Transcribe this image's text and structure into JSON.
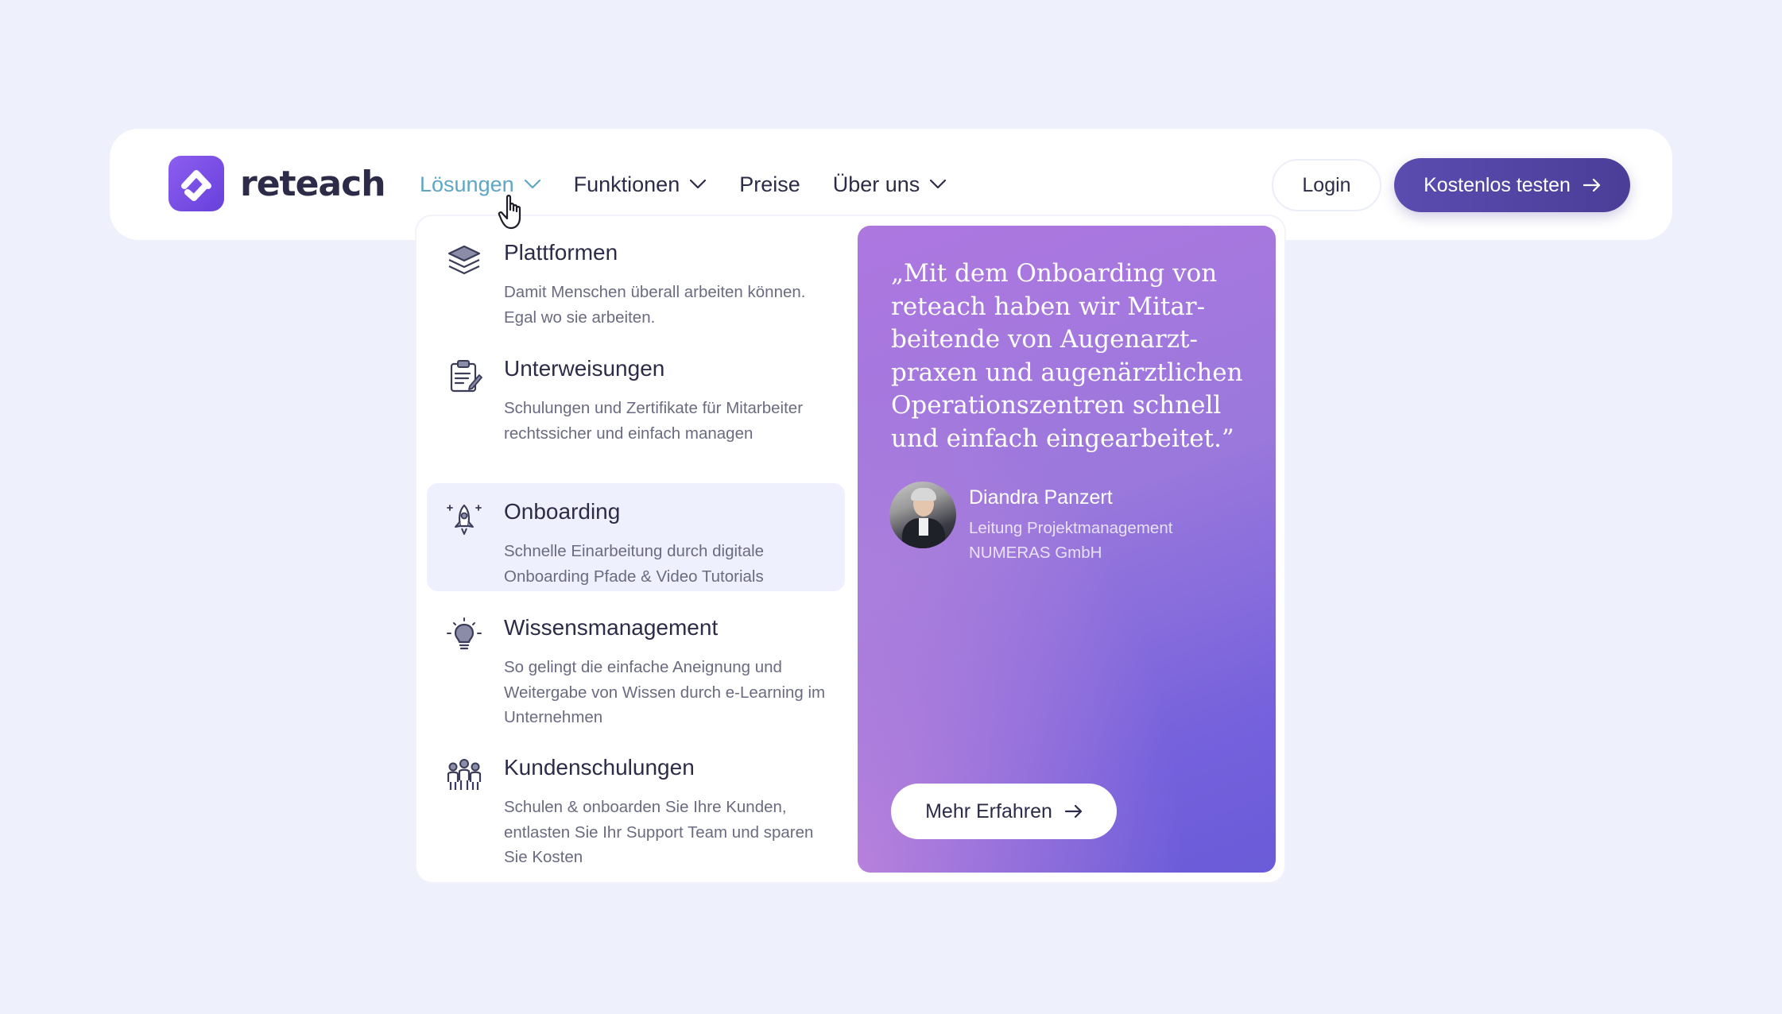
{
  "brand": {
    "name": "reteach",
    "color": "#7048e0"
  },
  "nav": {
    "items": [
      {
        "label": "Lösungen",
        "has_dropdown": true,
        "active": true
      },
      {
        "label": "Funktionen",
        "has_dropdown": true,
        "active": false
      },
      {
        "label": "Preise",
        "has_dropdown": false,
        "active": false
      },
      {
        "label": "Über uns",
        "has_dropdown": true,
        "active": false
      }
    ],
    "login_label": "Login",
    "cta_label": "Kostenlos testen"
  },
  "dropdown": {
    "items": [
      {
        "icon": "layers-icon",
        "title": "Plattformen",
        "desc": "Damit Menschen überall arbeiten können. Egal wo sie arbeiten.",
        "highlighted": false
      },
      {
        "icon": "clipboard-icon",
        "title": "Unterweisungen",
        "desc": "Schulungen und Zertifikate für Mitarbeiter rechtssicher und einfach managen",
        "highlighted": false
      },
      {
        "icon": "rocket-icon",
        "title": "Onboarding",
        "desc": "Schnelle Einarbeitung durch digitale Onboarding Pfade & Video Tutorials",
        "highlighted": true
      },
      {
        "icon": "lightbulb-icon",
        "title": "Wissensmanagement",
        "desc": "So gelingt die einfache Aneignung und Weitergabe von Wissen durch e-Learning im Unternehmen",
        "highlighted": false
      },
      {
        "icon": "people-group-icon",
        "title": "Kundenschulungen",
        "desc": "Schulen & onboarden Sie Ihre Kunden, entlasten Sie Ihr Support Team und sparen Sie Kosten",
        "highlighted": false
      }
    ],
    "testimonial": {
      "quote": "„Mit dem Onboarding von reteach haben wir Mitar-beitende von Augenarzt-praxen und augenärztlichen Operationszentren schnell und einfach eingearbeitet.”",
      "name": "Diandra Panzert",
      "role": "Leitung Projektmanagement",
      "company": "NUMERAS GmbH",
      "button_label": "Mehr Erfahren"
    }
  },
  "colors": {
    "page_bg": "#eef0fc",
    "active_nav": "#5fa6c4",
    "cta_bg": "#4f43a3",
    "highlight_bg": "#eef0fd"
  }
}
